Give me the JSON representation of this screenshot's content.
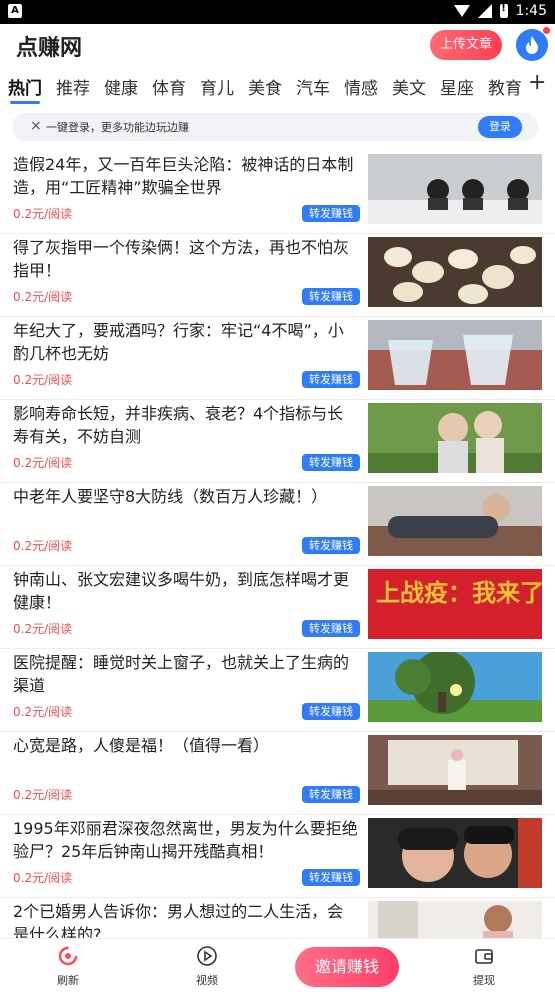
{
  "status_bar": {
    "left_icon": "A",
    "time": "1:45"
  },
  "header": {
    "app_title": "点赚网",
    "upload_label": "上传文章"
  },
  "tabs": [
    "热门",
    "推荐",
    "健康",
    "体育",
    "育儿",
    "美食",
    "汽车",
    "情感",
    "美文",
    "星座",
    "教育"
  ],
  "tabs_plus": "+",
  "login_banner": {
    "close": "×",
    "text": "一键登录，更多功能边玩边赚",
    "button": "登录"
  },
  "articles": [
    {
      "title": "造假24年，又一百年巨头沦陷：被神话的日本制造，用“工匠精神”欺骗全世界",
      "price": "0.2元/阅读",
      "share": "转发赚钱"
    },
    {
      "title": "得了灰指甲一个传染俩！这个方法，再也不怕灰指甲！",
      "price": "0.2元/阅读",
      "share": "转发赚钱"
    },
    {
      "title": "年纪大了，要戒酒吗？行家：牢记“4不喝”，小酌几杯也无妨",
      "price": "0.2元/阅读",
      "share": "转发赚钱"
    },
    {
      "title": "影响寿命长短，并非疾病、衰老？4个指标与长寿有关，不妨自测",
      "price": "0.2元/阅读",
      "share": "转发赚钱"
    },
    {
      "title": "中老年人要坚守8大防线（数百万人珍藏！）",
      "price": "0.2元/阅读",
      "share": "转发赚钱"
    },
    {
      "title": "钟南山、张文宏建议多喝牛奶，到底怎样喝才更健康！",
      "price": "0.2元/阅读",
      "share": "转发赚钱",
      "thumb_text": "上战疫：我来了!"
    },
    {
      "title": "医院提醒：睡觉时关上窗子，也就关上了生病的渠道",
      "price": "0.2元/阅读",
      "share": "转发赚钱"
    },
    {
      "title": "心宽是路，人傻是福！（值得一看）",
      "price": "0.2元/阅读",
      "share": "转发赚钱"
    },
    {
      "title": "1995年邓丽君深夜忽然离世，男友为什么要拒绝验尸？25年后钟南山揭开残酷真相！",
      "price": "0.2元/阅读",
      "share": "转发赚钱"
    },
    {
      "title": "2个已婚男人告诉你：男人想过的二人生活，会是什么样的?",
      "price": "",
      "share": ""
    }
  ],
  "bottom_nav": {
    "refresh": "刷新",
    "video": "视频",
    "invite": "邀请赚钱",
    "withdraw": "提现"
  },
  "colors": {
    "accent": "#2f7cf6",
    "price": "#ff4a4a",
    "invite": "#ff3e6a"
  }
}
